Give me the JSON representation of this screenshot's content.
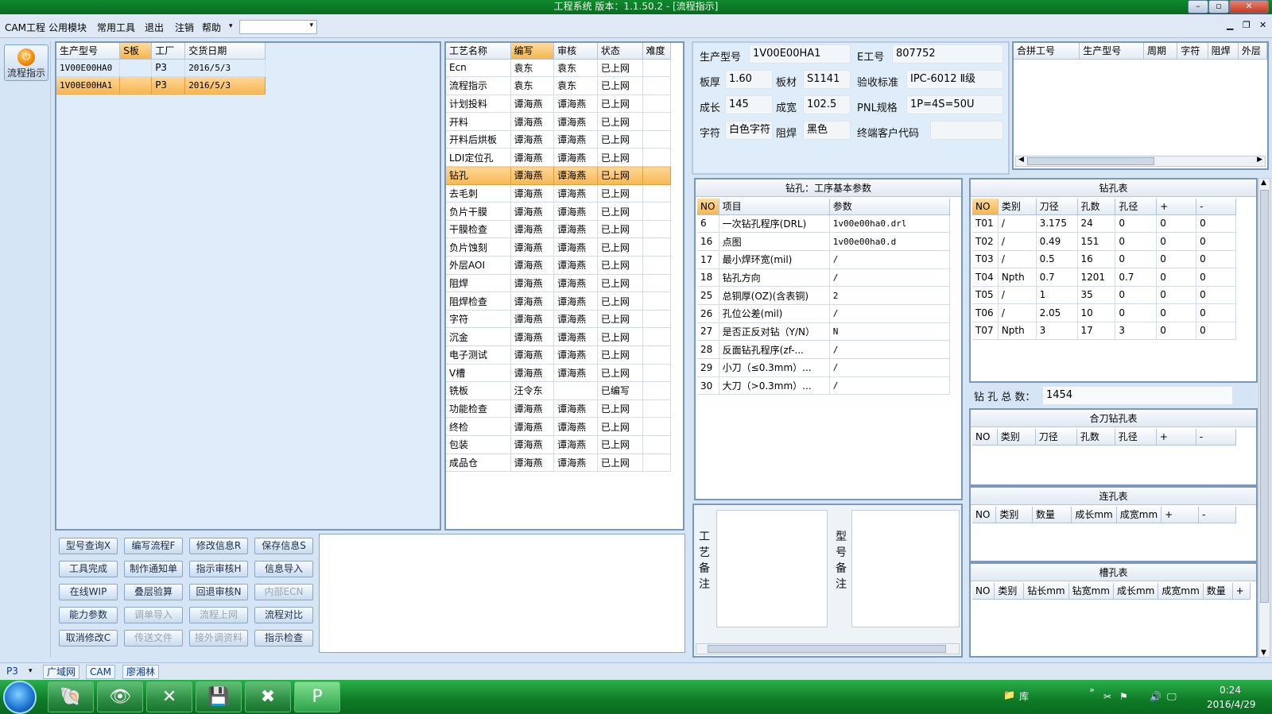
{
  "window": {
    "title": "工程系统   版本：1.1.50.2 - [流程指示]"
  },
  "menu": {
    "items": [
      "CAM工程",
      "公用模块",
      "常用工具",
      "退出",
      "注销",
      "帮助"
    ]
  },
  "launcher": {
    "flow_label": "流程指示"
  },
  "orders": {
    "headers": [
      "生产型号",
      "S板",
      "工厂",
      "交货日期"
    ],
    "rows": [
      [
        "1V00E00HA0",
        "",
        "P3",
        "2016/5/3"
      ],
      [
        "1V00E00HA1",
        "",
        "P3",
        "2016/5/3"
      ]
    ]
  },
  "process": {
    "headers": [
      "工艺名称",
      "编写",
      "审核",
      "状态",
      "难度"
    ],
    "rows": [
      [
        "Ecn",
        "袁东",
        "袁东",
        "已上网",
        ""
      ],
      [
        "流程指示",
        "袁东",
        "袁东",
        "已上网",
        ""
      ],
      [
        "计划投料",
        "谭海燕",
        "谭海燕",
        "已上网",
        ""
      ],
      [
        "开料",
        "谭海燕",
        "谭海燕",
        "已上网",
        ""
      ],
      [
        "开料后烘板",
        "谭海燕",
        "谭海燕",
        "已上网",
        ""
      ],
      [
        "LDI定位孔",
        "谭海燕",
        "谭海燕",
        "已上网",
        ""
      ],
      [
        "钻孔",
        "谭海燕",
        "谭海燕",
        "已上网",
        ""
      ],
      [
        "去毛刺",
        "谭海燕",
        "谭海燕",
        "已上网",
        ""
      ],
      [
        "负片干膜",
        "谭海燕",
        "谭海燕",
        "已上网",
        ""
      ],
      [
        "干膜检查",
        "谭海燕",
        "谭海燕",
        "已上网",
        ""
      ],
      [
        "负片蚀刻",
        "谭海燕",
        "谭海燕",
        "已上网",
        ""
      ],
      [
        "外层AOI",
        "谭海燕",
        "谭海燕",
        "已上网",
        ""
      ],
      [
        "阻焊",
        "谭海燕",
        "谭海燕",
        "已上网",
        ""
      ],
      [
        "阻焊检查",
        "谭海燕",
        "谭海燕",
        "已上网",
        ""
      ],
      [
        "字符",
        "谭海燕",
        "谭海燕",
        "已上网",
        ""
      ],
      [
        "沉金",
        "谭海燕",
        "谭海燕",
        "已上网",
        ""
      ],
      [
        "电子测试",
        "谭海燕",
        "谭海燕",
        "已上网",
        ""
      ],
      [
        "V槽",
        "谭海燕",
        "谭海燕",
        "已上网",
        ""
      ],
      [
        "铣板",
        "汪令东",
        "",
        "已编写",
        ""
      ],
      [
        "功能检查",
        "谭海燕",
        "谭海燕",
        "已上网",
        ""
      ],
      [
        "终检",
        "谭海燕",
        "谭海燕",
        "已上网",
        ""
      ],
      [
        "包装",
        "谭海燕",
        "谭海燕",
        "已上网",
        ""
      ],
      [
        "成品仓",
        "谭海燕",
        "谭海燕",
        "已上网",
        ""
      ]
    ]
  },
  "info": {
    "model_label": "生产型号",
    "model": "1V00E00HA1",
    "e_label": "E工号",
    "e_no": "807752",
    "thick_label": "板厚",
    "thick": "1.60",
    "mat_label": "板材",
    "mat": "S1141",
    "std_label": "验收标准",
    "std": "IPC-6012 Ⅱ级",
    "len_label": "成长",
    "len": "145",
    "wid_label": "成宽",
    "wid": "102.5",
    "pnl_label": "PNL规格",
    "pnl": "1P=4S=50U",
    "char_label": "字符",
    "char": "白色字符",
    "mask_label": "阻焊",
    "mask": "黑色",
    "cust_label": "终端客户代码",
    "cust": ""
  },
  "combine": {
    "headers": [
      "合拼工号",
      "生产型号",
      "周期",
      "字符",
      "阻焊",
      "外层"
    ]
  },
  "params": {
    "title": "钻孔：工序基本参数",
    "headers": [
      "NO",
      "项目",
      "参数"
    ],
    "rows": [
      [
        "6",
        "一次钻孔程序(DRL)",
        "1v00e00ha0.drl"
      ],
      [
        "16",
        "点图",
        "1v00e00ha0.d"
      ],
      [
        "17",
        "最小焊环宽(mil)",
        "/"
      ],
      [
        "18",
        "钻孔方向",
        "/"
      ],
      [
        "25",
        "总铜厚(OZ)(含表铜)",
        "2"
      ],
      [
        "26",
        "孔位公差(mil)",
        "/"
      ],
      [
        "27",
        "是否正反对钻（Y/N）",
        "N"
      ],
      [
        "28",
        "反面钻孔程序(zf-...",
        "/"
      ],
      [
        "29",
        "小刀（≤0.3mm）...",
        "/"
      ],
      [
        "30",
        "大刀（>0.3mm）...",
        "/"
      ]
    ]
  },
  "drill": {
    "title": "钻孔表",
    "headers": [
      "NO",
      "类别",
      "刀径",
      "孔数",
      "孔径",
      "+",
      "-"
    ],
    "rows": [
      [
        "T01",
        "/",
        "3.175",
        "24",
        "0",
        "0",
        "0"
      ],
      [
        "T02",
        "/",
        "0.49",
        "151",
        "0",
        "0",
        "0"
      ],
      [
        "T03",
        "/",
        "0.5",
        "16",
        "0",
        "0",
        "0"
      ],
      [
        "T04",
        "Npth",
        "0.7",
        "1201",
        "0.7",
        "0",
        "0"
      ],
      [
        "T05",
        "/",
        "1",
        "35",
        "0",
        "0",
        "0"
      ],
      [
        "T06",
        "/",
        "2.05",
        "10",
        "0",
        "0",
        "0"
      ],
      [
        "T07",
        "Npth",
        "3",
        "17",
        "3",
        "0",
        "0"
      ]
    ],
    "total_label": "钻 孔 总 数：",
    "total": "1454"
  },
  "combo_drill": {
    "title": "合刀钻孔表",
    "headers": [
      "NO",
      "类别",
      "刀径",
      "孔数",
      "孔径",
      "+",
      "-"
    ]
  },
  "slot_link": {
    "title": "连孔表",
    "headers": [
      "NO",
      "类别",
      "数量",
      "成长mm",
      "成宽mm",
      "+",
      "-"
    ]
  },
  "slot": {
    "title": "槽孔表",
    "headers": [
      "NO",
      "类别",
      "钻长mm",
      "钻宽mm",
      "成长mm",
      "成宽mm",
      "数量",
      "+"
    ]
  },
  "notes": {
    "process_label": "工艺备注",
    "model_label": "型号备注"
  },
  "buttons": [
    [
      "型号查询X",
      "编写流程F",
      "修改信息R",
      "保存信息S"
    ],
    [
      "工具完成",
      "制作通知单",
      "指示审核H",
      "信息导入"
    ],
    [
      "在线WIP",
      "叠层验算",
      "回退审核N",
      "内部ECN"
    ],
    [
      "能力参数",
      "调单导入",
      "流程上网",
      "流程对比"
    ],
    [
      "取消修改C",
      "传送文件",
      "接外调资料",
      "指示检查"
    ]
  ],
  "status": {
    "factory": "P3",
    "tabs": [
      "广域网",
      "CAM",
      "廖湘林"
    ]
  },
  "taskbar": {
    "tray_label": "库",
    "time": "0:24",
    "date": "2016/4/29"
  }
}
